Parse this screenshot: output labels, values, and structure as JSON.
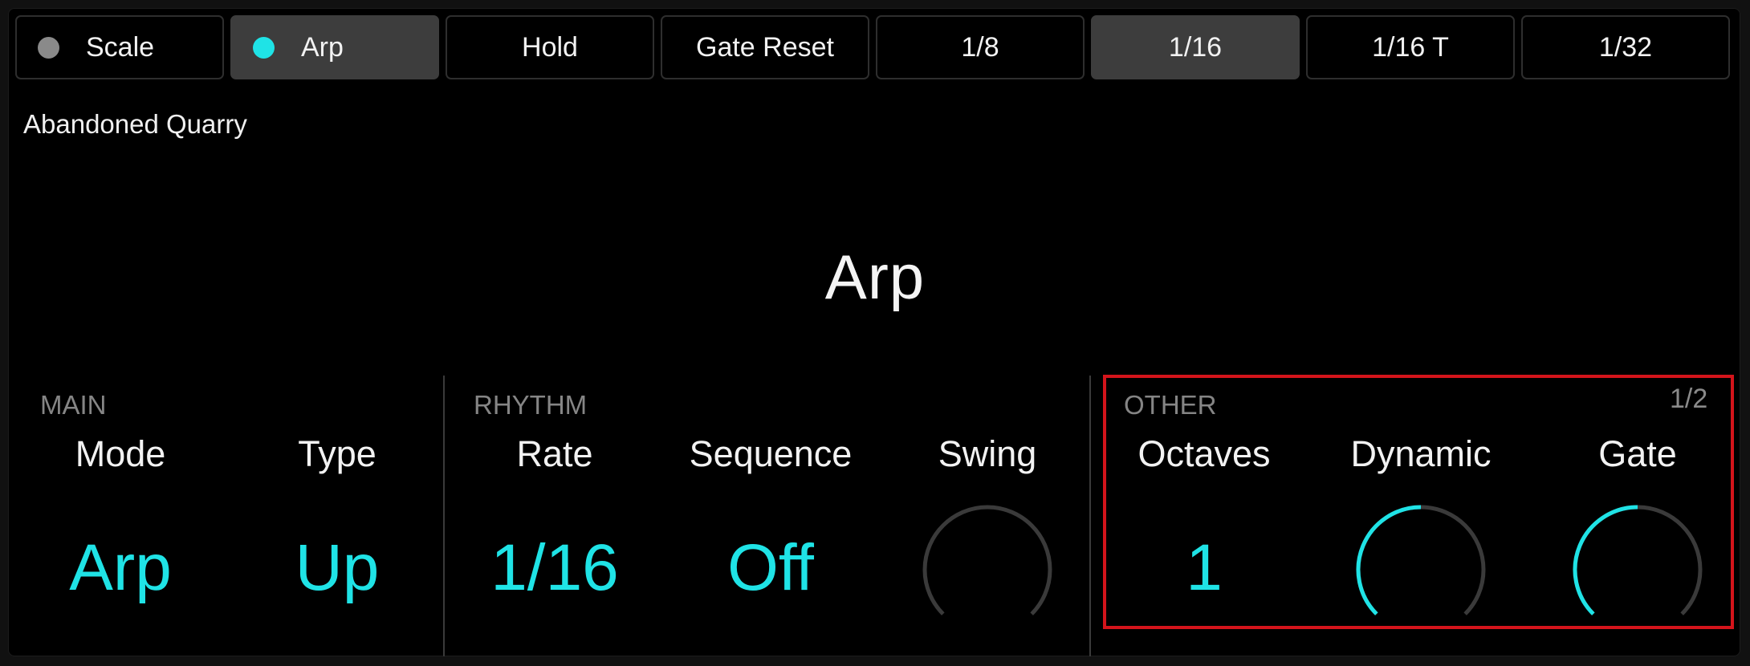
{
  "colors": {
    "accent": "#1fe3e6",
    "inactive_dot": "#8a8a8a",
    "knob_track": "#3a3a3a",
    "highlight_border": "#d4141b",
    "active_tab_bg": "#3d3d3d"
  },
  "tabs": [
    {
      "label": "Scale",
      "dot": "grey",
      "active": false
    },
    {
      "label": "Arp",
      "dot": "cyan",
      "active": true
    },
    {
      "label": "Hold",
      "active": false
    },
    {
      "label": "Gate Reset",
      "active": false
    },
    {
      "label": "1/8",
      "active": false
    },
    {
      "label": "1/16",
      "active": true
    },
    {
      "label": "1/16 T",
      "active": false
    },
    {
      "label": "1/32",
      "active": false
    }
  ],
  "preset_name": "Abandoned Quarry",
  "device_title": "Arp",
  "sections": {
    "main": {
      "label": "MAIN",
      "params": [
        {
          "name": "Mode",
          "value": "Arp"
        },
        {
          "name": "Type",
          "value": "Up"
        }
      ]
    },
    "rhythm": {
      "label": "RHYTHM",
      "params": [
        {
          "name": "Rate",
          "value": "1/16"
        },
        {
          "name": "Sequence",
          "value": "Off"
        },
        {
          "name": "Swing",
          "knob_fraction": 0.0
        }
      ]
    },
    "other": {
      "label": "OTHER",
      "page": "1/2",
      "params": [
        {
          "name": "Octaves",
          "value": "1"
        },
        {
          "name": "Dynamic",
          "knob_fraction": 0.5
        },
        {
          "name": "Gate",
          "knob_fraction": 0.5
        }
      ]
    }
  }
}
